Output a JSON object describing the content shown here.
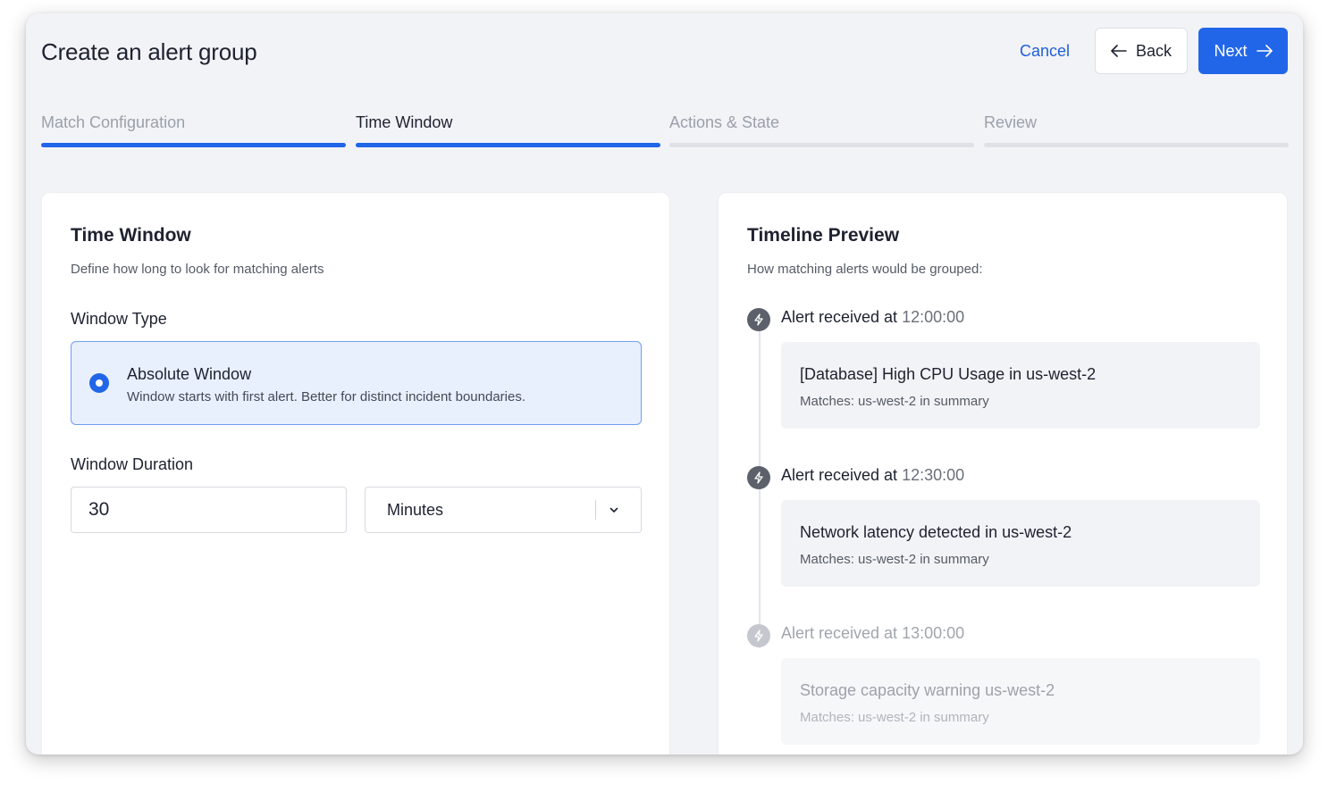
{
  "header": {
    "title": "Create an alert group",
    "cancel_label": "Cancel",
    "back_label": "Back",
    "next_label": "Next"
  },
  "steps": [
    {
      "label": "Match Configuration",
      "state": "done"
    },
    {
      "label": "Time Window",
      "state": "active"
    },
    {
      "label": "Actions & State",
      "state": "pending"
    },
    {
      "label": "Review",
      "state": "pending"
    }
  ],
  "time_window": {
    "title": "Time Window",
    "subtitle": "Define how long to look for matching alerts",
    "window_type_label": "Window Type",
    "option": {
      "title": "Absolute Window",
      "description": "Window starts with first alert. Better for distinct incident boundaries.",
      "selected": true
    },
    "duration_label": "Window Duration",
    "duration_value": "30",
    "unit_value": "Minutes"
  },
  "timeline": {
    "title": "Timeline Preview",
    "subtitle": "How matching alerts would be grouped:",
    "items": [
      {
        "prefix": "Alert received at",
        "time": "12:00:00",
        "title": "[Database] High CPU Usage in us-west-2",
        "match": "Matches: us-west-2 in summary"
      },
      {
        "prefix": "Alert received at",
        "time": "12:30:00",
        "title": "Network latency detected in us-west-2",
        "match": "Matches: us-west-2 in summary"
      },
      {
        "prefix": "Alert received at",
        "time": "13:00:00",
        "title": "Storage capacity warning us-west-2",
        "match": "Matches: us-west-2 in summary"
      }
    ]
  },
  "colors": {
    "accent": "#2166e8",
    "background": "#f2f3f6",
    "selected_bg": "#e9f0fd"
  },
  "icons": {
    "back": "arrow-left-icon",
    "next": "arrow-right-icon",
    "select": "chevron-down-icon",
    "alert": "bolt-icon"
  }
}
